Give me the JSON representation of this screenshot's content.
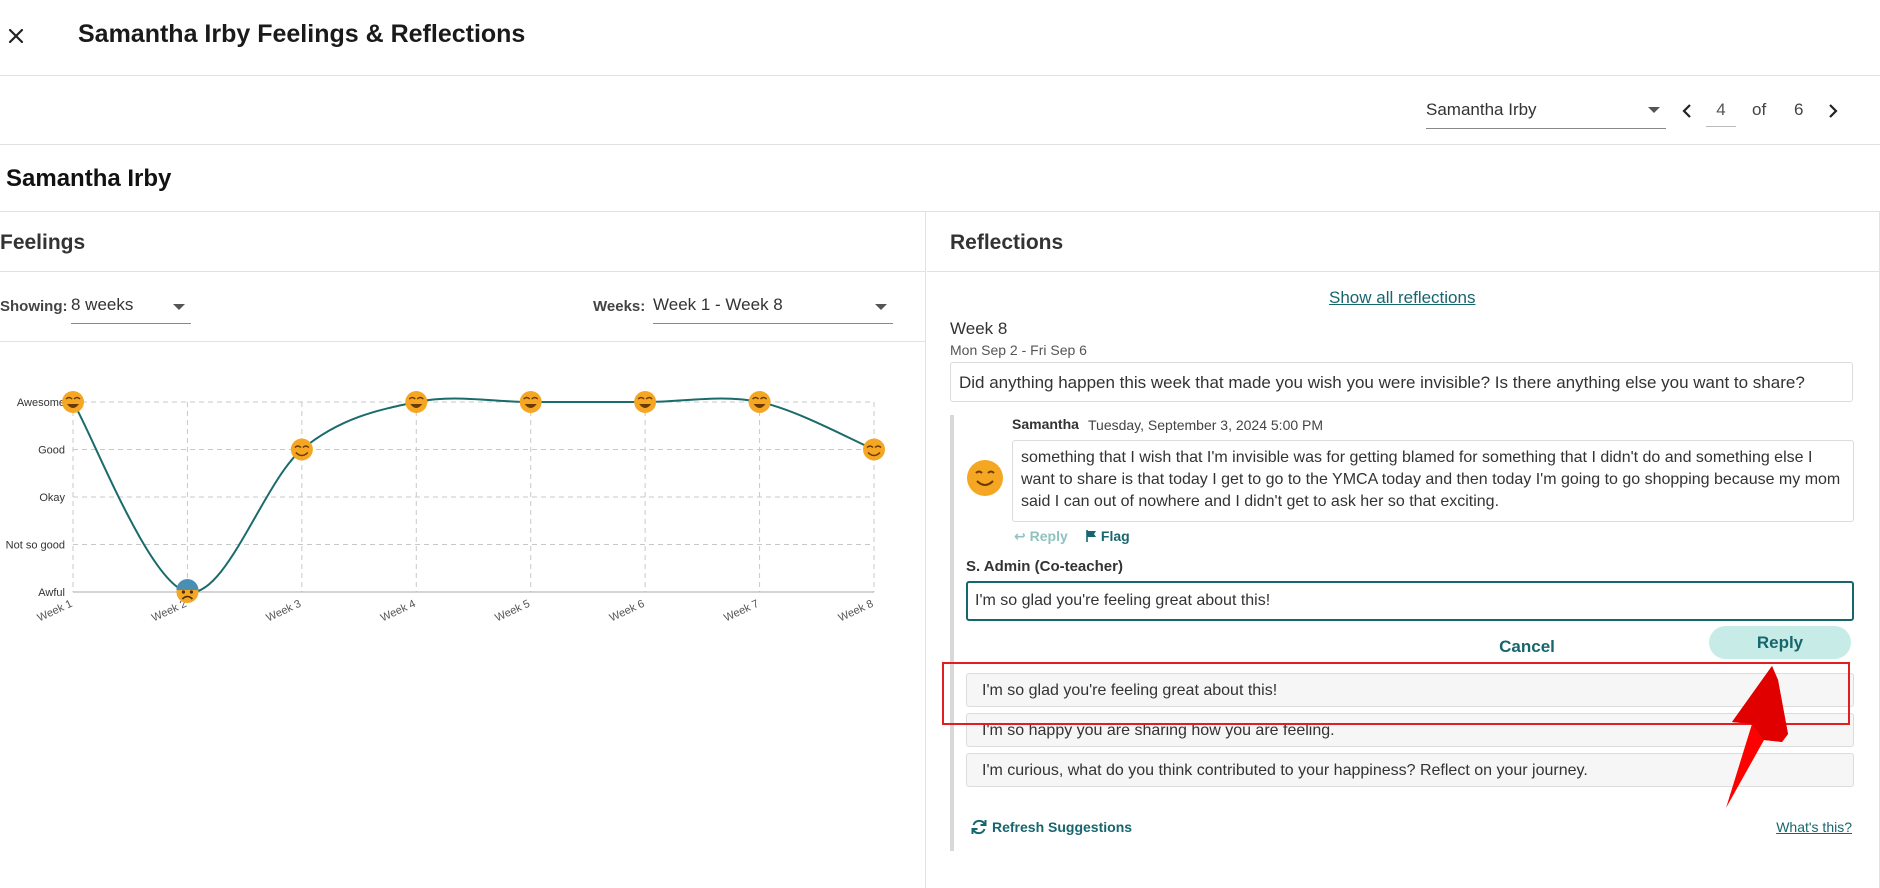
{
  "header": {
    "title": "Samantha Irby Feelings & Reflections"
  },
  "navigator": {
    "student": "Samantha Irby",
    "page": "4",
    "of_label": "of",
    "total": "6"
  },
  "student": {
    "name": "Samantha Irby"
  },
  "feelings": {
    "title": "Feelings",
    "showing_label": "Showing:",
    "showing_value": "8 weeks",
    "weeks_label": "Weeks:",
    "weeks_value": "Week 1 - Week 8"
  },
  "chart_data": {
    "type": "line",
    "categories": [
      "Week 1",
      "Week 2",
      "Week 3",
      "Week 4",
      "Week 5",
      "Week 6",
      "Week 7",
      "Week 8"
    ],
    "y_levels": [
      "Awful",
      "Not so good",
      "Okay",
      "Good",
      "Awesome"
    ],
    "series": [
      {
        "values": [
          5,
          1,
          4,
          5,
          5,
          5,
          5,
          4
        ]
      }
    ],
    "grid": true,
    "line_color": "#1a6b6b",
    "marker_color": "#f5a623"
  },
  "reflections": {
    "title": "Reflections",
    "show_all": "Show all reflections",
    "week": "Week 8",
    "date_range": "Mon Sep 2 - Fri Sep 6",
    "prompt": "Did anything happen this week that made you wish you were invisible? Is there anything else you want to share?",
    "author": "Samantha",
    "timestamp": "Tuesday, September 3, 2024 5:00 PM",
    "message": "something that I wish that I'm invisible was for getting blamed for something that I didn't do and something else I want to share is that today I get to go to the YMCA today and then today I'm going to go shopping because my mom said I can out of nowhere and I didn't get to ask her so that exciting.",
    "reply_action": "Reply",
    "flag_action": "Flag",
    "responder": "S. Admin (Co-teacher)",
    "reply_input_value": "I'm so glad you're feeling great about this!",
    "cancel": "Cancel",
    "reply": "Reply",
    "suggestions": [
      "I'm so glad you're feeling great about this!",
      "I'm so happy you are sharing how you are feeling.",
      "I'm curious, what do you think contributed to your happiness? Reflect on your journey."
    ],
    "refresh": "Refresh Suggestions",
    "whats_this": "What's this?"
  },
  "colors": {
    "accent": "#17666e",
    "reply_bg": "#c7ece8",
    "annotation": "#e02020"
  }
}
